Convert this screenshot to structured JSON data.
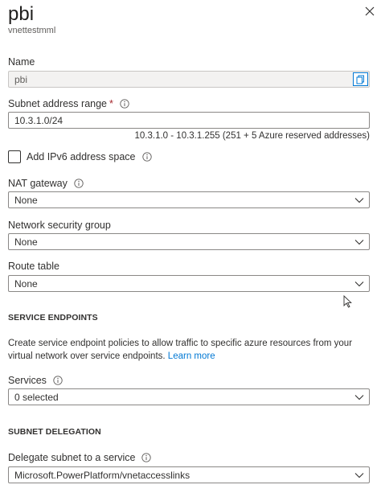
{
  "header": {
    "title": "pbi",
    "subtitle": "vnettestmml"
  },
  "name": {
    "label": "Name",
    "value": "pbi"
  },
  "subnet_range": {
    "label": "Subnet address range",
    "required_mark": "*",
    "value": "10.3.1.0/24",
    "hint": "10.3.1.0 - 10.3.1.255 (251 + 5 Azure reserved addresses)"
  },
  "ipv6": {
    "label": "Add IPv6 address space",
    "checked": false
  },
  "nat_gateway": {
    "label": "NAT gateway",
    "value": "None"
  },
  "nsg": {
    "label": "Network security group",
    "value": "None"
  },
  "route_table": {
    "label": "Route table",
    "value": "None"
  },
  "service_endpoints": {
    "heading": "SERVICE ENDPOINTS",
    "description": "Create service endpoint policies to allow traffic to specific azure resources from your virtual network over service endpoints.",
    "learn_more": "Learn more",
    "services_label": "Services",
    "services_value": "0 selected"
  },
  "subnet_delegation": {
    "heading": "SUBNET DELEGATION",
    "label": "Delegate subnet to a service",
    "value": "Microsoft.PowerPlatform/vnetaccesslinks"
  },
  "colors": {
    "accent": "#0078d4",
    "required": "#a4262c",
    "border": "#8a8886"
  }
}
